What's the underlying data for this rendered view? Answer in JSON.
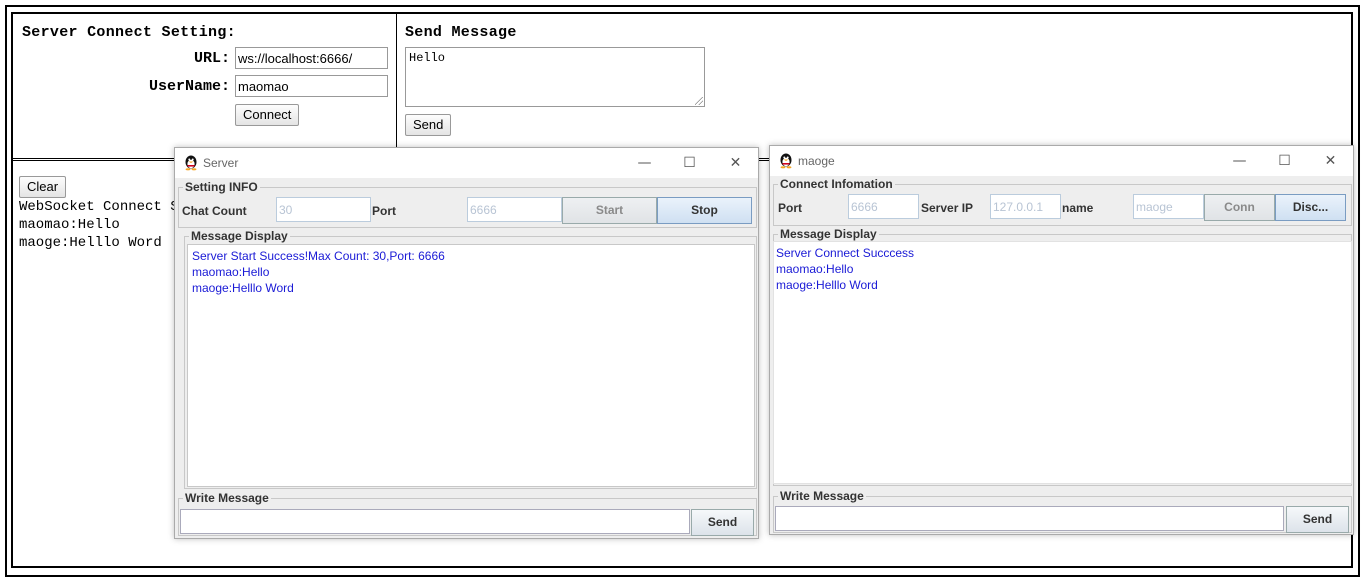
{
  "web": {
    "connect": {
      "title": "Server Connect Setting:",
      "url_label": "URL:",
      "url_value": "ws://localhost:6666/",
      "username_label": "UserName:",
      "username_value": "maomao",
      "connect_button": "Connect"
    },
    "send": {
      "title": "Send Message",
      "message_value": "Hello",
      "send_button": "Send"
    },
    "log": {
      "clear_button": "Clear",
      "lines": [
        "WebSocket Connect Su",
        "maomao:Hello",
        "maoge:Helllo Word"
      ]
    }
  },
  "server_window": {
    "title": "Server",
    "controls": {
      "minimize": "—",
      "maximize": "☐",
      "close": "✕"
    },
    "setting_group": "Setting INFO",
    "chat_count_label": "Chat Count",
    "chat_count_value": "30",
    "port_label": "Port",
    "port_value": "6666",
    "start_button": "Start",
    "stop_button": "Stop",
    "display_group": "Message Display",
    "messages": [
      "Server Start Success!Max Count:  30,Port:  6666",
      "maomao:Hello",
      "maoge:Helllo Word"
    ],
    "write_group": "Write Message",
    "send_button": "Send"
  },
  "client_window": {
    "title": "maoge",
    "controls": {
      "minimize": "—",
      "maximize": "☐",
      "close": "✕"
    },
    "connect_group": "Connect Infomation",
    "port_label": "Port",
    "port_value": "6666",
    "server_ip_label": "Server IP",
    "server_ip_value": "127.0.0.1",
    "name_label": "name",
    "name_value": "maoge",
    "conn_button": "Conn",
    "disc_button": "Disc...",
    "display_group": "Message Display",
    "messages": [
      "Server Connect Succcess",
      "maomao:Hello",
      "maoge:Helllo Word"
    ],
    "write_group": "Write Message",
    "send_button": "Send"
  },
  "colors": {
    "message_text": "#1a1ad6",
    "disabled_field_text": "#b8c4d4"
  }
}
